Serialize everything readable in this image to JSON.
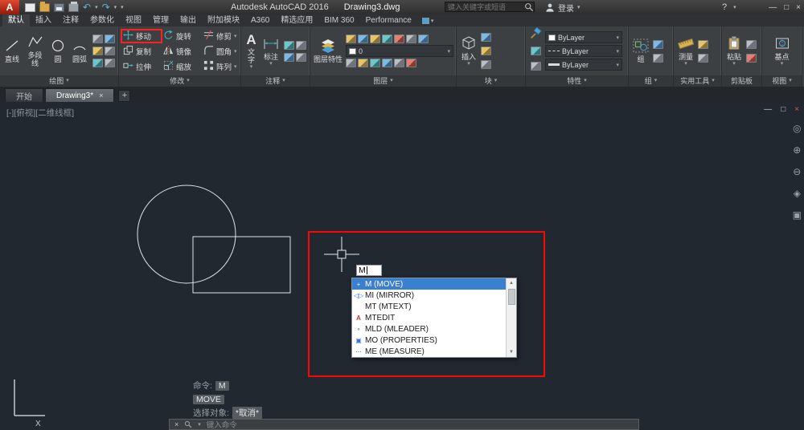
{
  "titlebar": {
    "logo": "A",
    "app_title": "Autodesk AutoCAD 2016",
    "doc_title": "Drawing3.dwg",
    "search_placeholder": "键入关键字或短语",
    "signin": "登录",
    "help": "?"
  },
  "glyphs": {
    "caret": "▾",
    "undo": "↶",
    "redo": "↷",
    "minimize": "—",
    "maximize": "□",
    "close": "×",
    "add": "+",
    "scroll_up": "▲",
    "scroll_down": "▼"
  },
  "ribbon_tabs": {
    "items": [
      "默认",
      "插入",
      "注释",
      "参数化",
      "视图",
      "管理",
      "输出",
      "附加模块",
      "A360",
      "精选应用",
      "BIM 360",
      "Performance"
    ],
    "active": "默认"
  },
  "panels": {
    "draw": {
      "label": "绘图",
      "line": "直线",
      "polyline": "多段线",
      "circle": "圆",
      "arc": "圆弧"
    },
    "modify": {
      "label": "修改",
      "move": "移动",
      "rotate": "旋转",
      "trim": "修剪",
      "copy": "复制",
      "mirror": "镜像",
      "fillet": "圆角",
      "stretch": "拉伸",
      "scale": "缩放",
      "array": "阵列"
    },
    "annotation": {
      "label": "注释",
      "text": "文字",
      "dimension": "标注"
    },
    "layers": {
      "label": "图层",
      "layer_properties": "图层特性",
      "current_layer": "0"
    },
    "block": {
      "label": "块",
      "insert": "插入"
    },
    "properties": {
      "label": "特性",
      "color_value": "ByLayer",
      "linetype_value": "ByLayer",
      "lineweight_value": "ByLayer"
    },
    "groups": {
      "label": "组",
      "group": "组"
    },
    "utilities": {
      "label": "实用工具",
      "measure": "测量"
    },
    "clipboard": {
      "label": "剪贴板",
      "paste": "粘贴"
    },
    "view": {
      "label": "视图",
      "base": "基点"
    }
  },
  "file_tabs": {
    "start": "开始",
    "drawing": "Drawing3*"
  },
  "canvas": {
    "viewport_controls": "[-][俯视][二维线框]",
    "command_input": "M",
    "autocomplete": [
      {
        "label": "M (MOVE)",
        "selected": true,
        "icon": "+"
      },
      {
        "label": "MI (MIRROR)",
        "selected": false,
        "icon": "◁▷"
      },
      {
        "label": "MT (MTEXT)",
        "selected": false,
        "icon": ""
      },
      {
        "label": "MTEDIT",
        "selected": false,
        "icon": "A"
      },
      {
        "label": "MLD (MLEADER)",
        "selected": false,
        "icon": "∘"
      },
      {
        "label": "MO (PROPERTIES)",
        "selected": false,
        "icon": "▣"
      },
      {
        "label": "ME (MEASURE)",
        "selected": false,
        "icon": "⋯"
      }
    ],
    "history": {
      "line1_prefix": "命令:",
      "line1_chip": "M",
      "line2_chip": "MOVE",
      "line3_prefix": "选择对象:",
      "line3_chip": "*取消*"
    },
    "command_prompt": "键入命令",
    "ucs_x_label": "X",
    "nav_icons": [
      "◎",
      "⊕",
      "⊖",
      "◈",
      "▣"
    ]
  },
  "colors": {
    "canvas_bg": "#212830",
    "annotation_red": "#fe0504",
    "selection_blue": "#3a80d2",
    "ribbon_bg": "#3d4043"
  }
}
